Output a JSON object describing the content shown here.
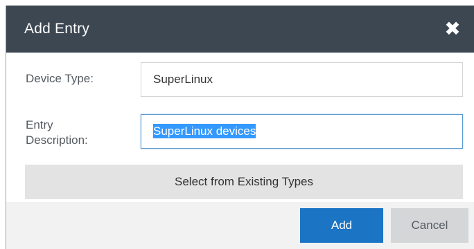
{
  "dialog": {
    "title": "Add Entry",
    "close_icon": "close-icon"
  },
  "form": {
    "device_type_label": "Device Type:",
    "device_type_value": "SuperLinux",
    "entry_description_label_line1": "Entry",
    "entry_description_label_line2": "Description:",
    "entry_description_value": "SuperLinux devices",
    "select_existing_label": "Select from Existing Types"
  },
  "footer": {
    "add_label": "Add",
    "cancel_label": "Cancel"
  },
  "colors": {
    "title_bar": "#3d4752",
    "primary_button": "#1b74c4",
    "secondary_button": "#d4d6d8",
    "select_button": "#e3e3e3",
    "footer_bg": "#f2f2f2",
    "focus_border": "#5b9bd5",
    "text_selection": "#3399ff"
  }
}
